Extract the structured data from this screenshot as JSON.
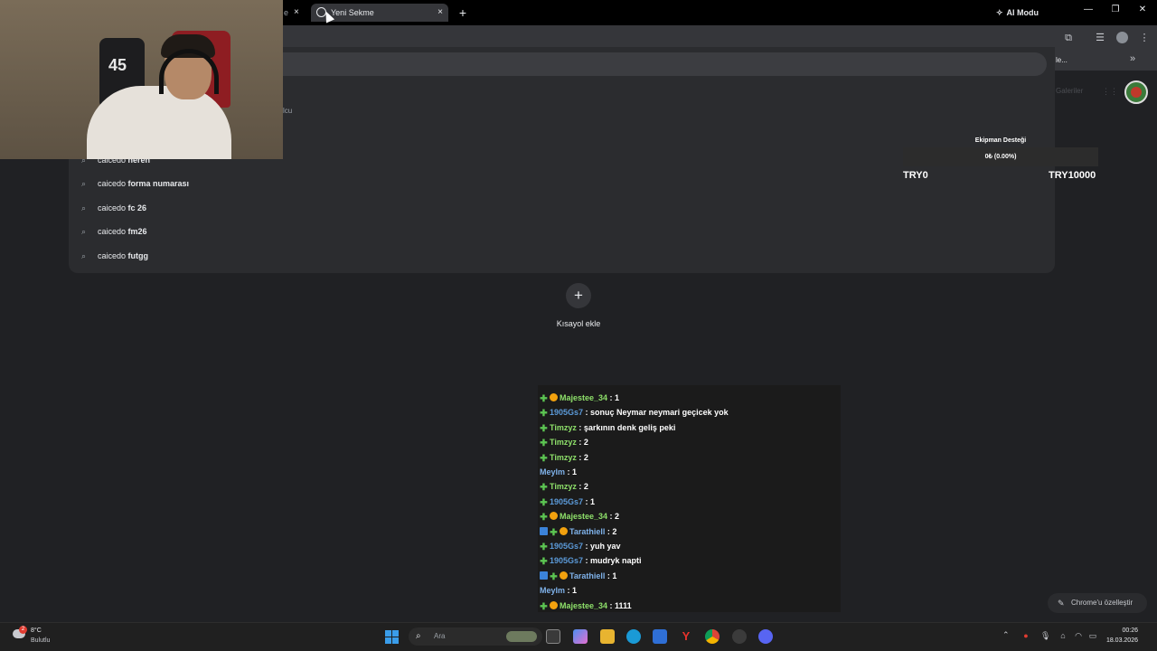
{
  "browser": {
    "tab_title": "Yeni Sekme",
    "tab_close": "×",
    "new_tab": "+",
    "prev_tab_close": "×",
    "prev_tab_fragment": "e",
    "window_minimize": "—",
    "window_maximize": "❐",
    "window_close": "✕",
    "ai_mode": "AI Modu",
    "bookmark_fragment": "le...",
    "bookmark_more": "»",
    "gallery_fragment": "Galeriler"
  },
  "omnibox": {
    "fragment_left": "lcu",
    "suggestions": [
      {
        "prefix": "caicedo",
        "suffix": " neren"
      },
      {
        "prefix": "caicedo",
        "suffix": " forma numarası"
      },
      {
        "prefix": "caicedo",
        "suffix": " fc 26"
      },
      {
        "prefix": "caicedo",
        "suffix": " fm26"
      },
      {
        "prefix": "caicedo",
        "suffix": " futgg"
      }
    ]
  },
  "donation": {
    "title": "Ekipman Desteği",
    "amount": "0₺ (0.00%)",
    "min": "TRY0",
    "max": "TRY10000",
    "progress_percent": 0
  },
  "shortcut": {
    "icon": "+",
    "label": "Kısayol ekle"
  },
  "chat": {
    "messages": [
      {
        "user": "Majestee_34",
        "text": " : 1"
      },
      {
        "user": "1905Gs7",
        "text": " : sonuç Neymar neymari geçicek yok"
      },
      {
        "user": "Timzyz",
        "text": " : şarkının denk geliş peki"
      },
      {
        "user": "Timzyz",
        "text": " : 2"
      },
      {
        "user": "Timzyz",
        "text": " : 2"
      },
      {
        "user": "Meylm",
        "text": " : 1"
      },
      {
        "user": "Timzyz",
        "text": " : 2"
      },
      {
        "user": "1905Gs7",
        "text": " : 1"
      },
      {
        "user": "Majestee_34",
        "text": " : 2"
      },
      {
        "user": "Tarathiell",
        "text": " : 2"
      },
      {
        "user": "1905Gs7",
        "text": " : yuh yav"
      },
      {
        "user": "1905Gs7",
        "text": " : mudryk napti"
      },
      {
        "user": "Tarathiell",
        "text": " : 1"
      },
      {
        "user": "Meylm",
        "text": " : 1"
      },
      {
        "user": "Majestee_34",
        "text": " : 1111"
      }
    ]
  },
  "customize": {
    "label": "Chrome'u özelleştir"
  },
  "webcam": {
    "jersey_number": "45"
  },
  "taskbar": {
    "weather_temp": "8°C",
    "weather_desc": "Bulutlu",
    "weather_badge": "2",
    "search_placeholder": "Ara",
    "time": "00:26",
    "date": "18.03.2026"
  }
}
